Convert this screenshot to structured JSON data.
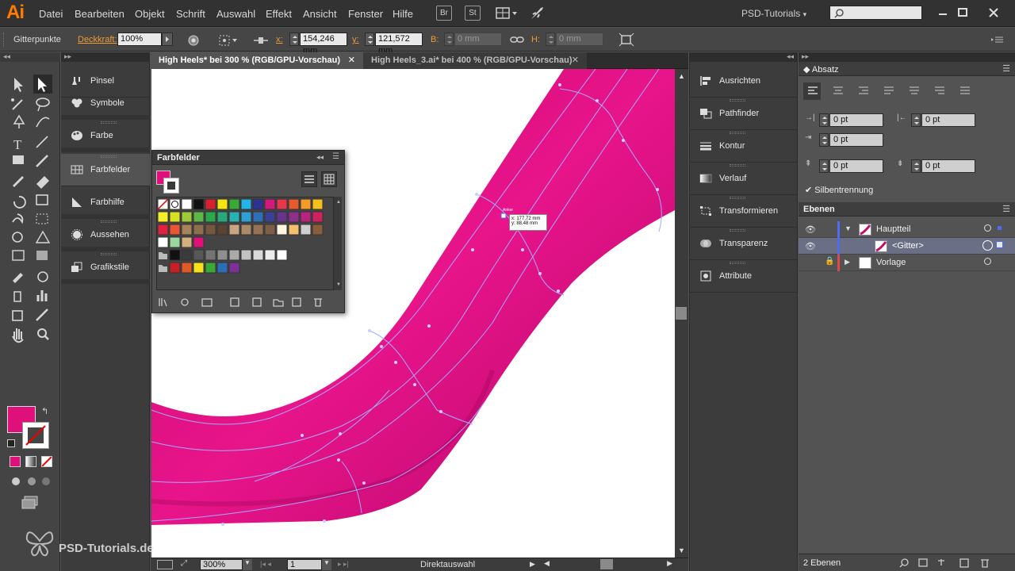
{
  "app": {
    "logo": "Ai",
    "workspace": "PSD-Tutorials",
    "bridge_label": "Br",
    "stock_label": "St"
  },
  "menu": [
    "Datei",
    "Bearbeiten",
    "Objekt",
    "Schrift",
    "Auswahl",
    "Effekt",
    "Ansicht",
    "Fenster",
    "Hilfe"
  ],
  "control": {
    "selection_label": "Gitterpunkte",
    "opacity_label": "Deckkraft:",
    "opacity_value": "100%",
    "x_label": "x:",
    "x_value": "154,246 mm",
    "y_label": "y:",
    "y_value": "121,572 mm",
    "b_label": "B:",
    "b_value": "0 mm",
    "h_label": "H:",
    "h_value": "0 mm"
  },
  "tabs": [
    {
      "label": "High Heels* bei 300 % (RGB/GPU-Vorschau)"
    },
    {
      "label": "High Heels_3.ai* bei 400 % (RGB/GPU-Vorschau)"
    }
  ],
  "left_dock": [
    "Pinsel",
    "Symbole",
    "Farbe",
    "Farbfelder",
    "Farbhilfe",
    "Aussehen",
    "Grafikstile"
  ],
  "right_dock": [
    "Ausrichten",
    "Pathfinder",
    "Kontur",
    "Verlauf",
    "Transformieren",
    "Transparenz",
    "Attribute"
  ],
  "farbfelder": {
    "title": "Farbfelder"
  },
  "tooltip": {
    "title": "Anker",
    "x": "x: 177,72 mm",
    "y": "y: 88,48 mm"
  },
  "absatz": {
    "title": "Absatz",
    "fields": [
      "0 pt",
      "0 pt",
      "0 pt",
      "0 pt",
      "0 pt"
    ],
    "hyphenation": "Silbentrennung"
  },
  "ebenen": {
    "title": "Ebenen",
    "layers": [
      "Hauptteil",
      "<Gitter>",
      "Vorlage"
    ],
    "footer": "2 Ebenen"
  },
  "status": {
    "zoom": "300%",
    "artboard": "1",
    "tool": "Direktauswahl"
  },
  "watermark": "PSD-Tutorials.de",
  "colors": {
    "magenta": "#e0107a",
    "accent_orange": "#ff7c00",
    "mesh_line": "#a4a8ff"
  }
}
